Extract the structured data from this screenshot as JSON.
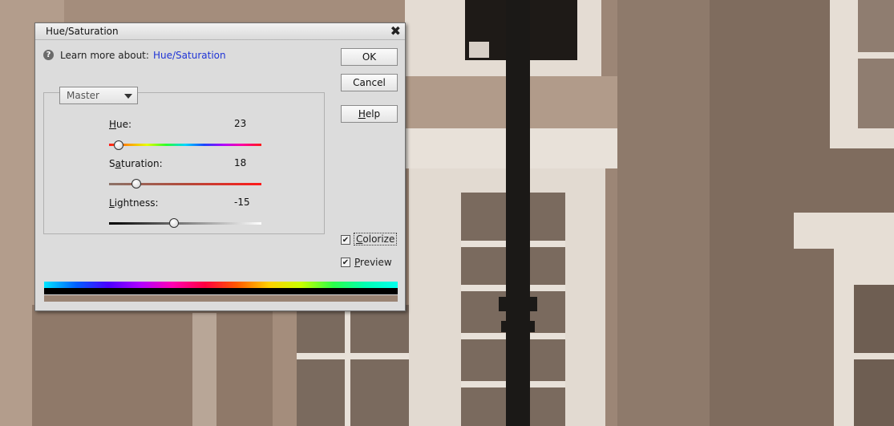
{
  "dialog": {
    "title": "Hue/Saturation",
    "close_glyph": "✖"
  },
  "learn": {
    "text": "Learn more about:",
    "link": "Hue/Saturation",
    "icon": "help-circle-icon"
  },
  "buttons": {
    "ok": "OK",
    "cancel": "Cancel",
    "help_prefix": "",
    "help_u": "H",
    "help_rest": "elp"
  },
  "edit_dropdown": {
    "selected": "Master"
  },
  "sliders": {
    "hue": {
      "label_u": "H",
      "label_rest": "ue:",
      "value": "23",
      "min": 0,
      "max": 360,
      "num": 23
    },
    "saturation": {
      "label_pre": "S",
      "label_u": "a",
      "label_rest": "turation:",
      "value": "18",
      "min": 0,
      "max": 100,
      "num": 18
    },
    "lightness": {
      "label_u": "L",
      "label_rest": "ightness:",
      "value": "-15",
      "min": -100,
      "max": 100,
      "num": -15
    }
  },
  "checkboxes": {
    "colorize": {
      "label_u": "C",
      "label_rest": "olorize",
      "checked": true
    },
    "preview": {
      "label_u": "P",
      "label_rest": "review",
      "checked": true
    }
  },
  "colors": {
    "link": "#1f34d6",
    "dialog_bg": "#dcdcdc",
    "photo_tone": "#9a8474"
  }
}
